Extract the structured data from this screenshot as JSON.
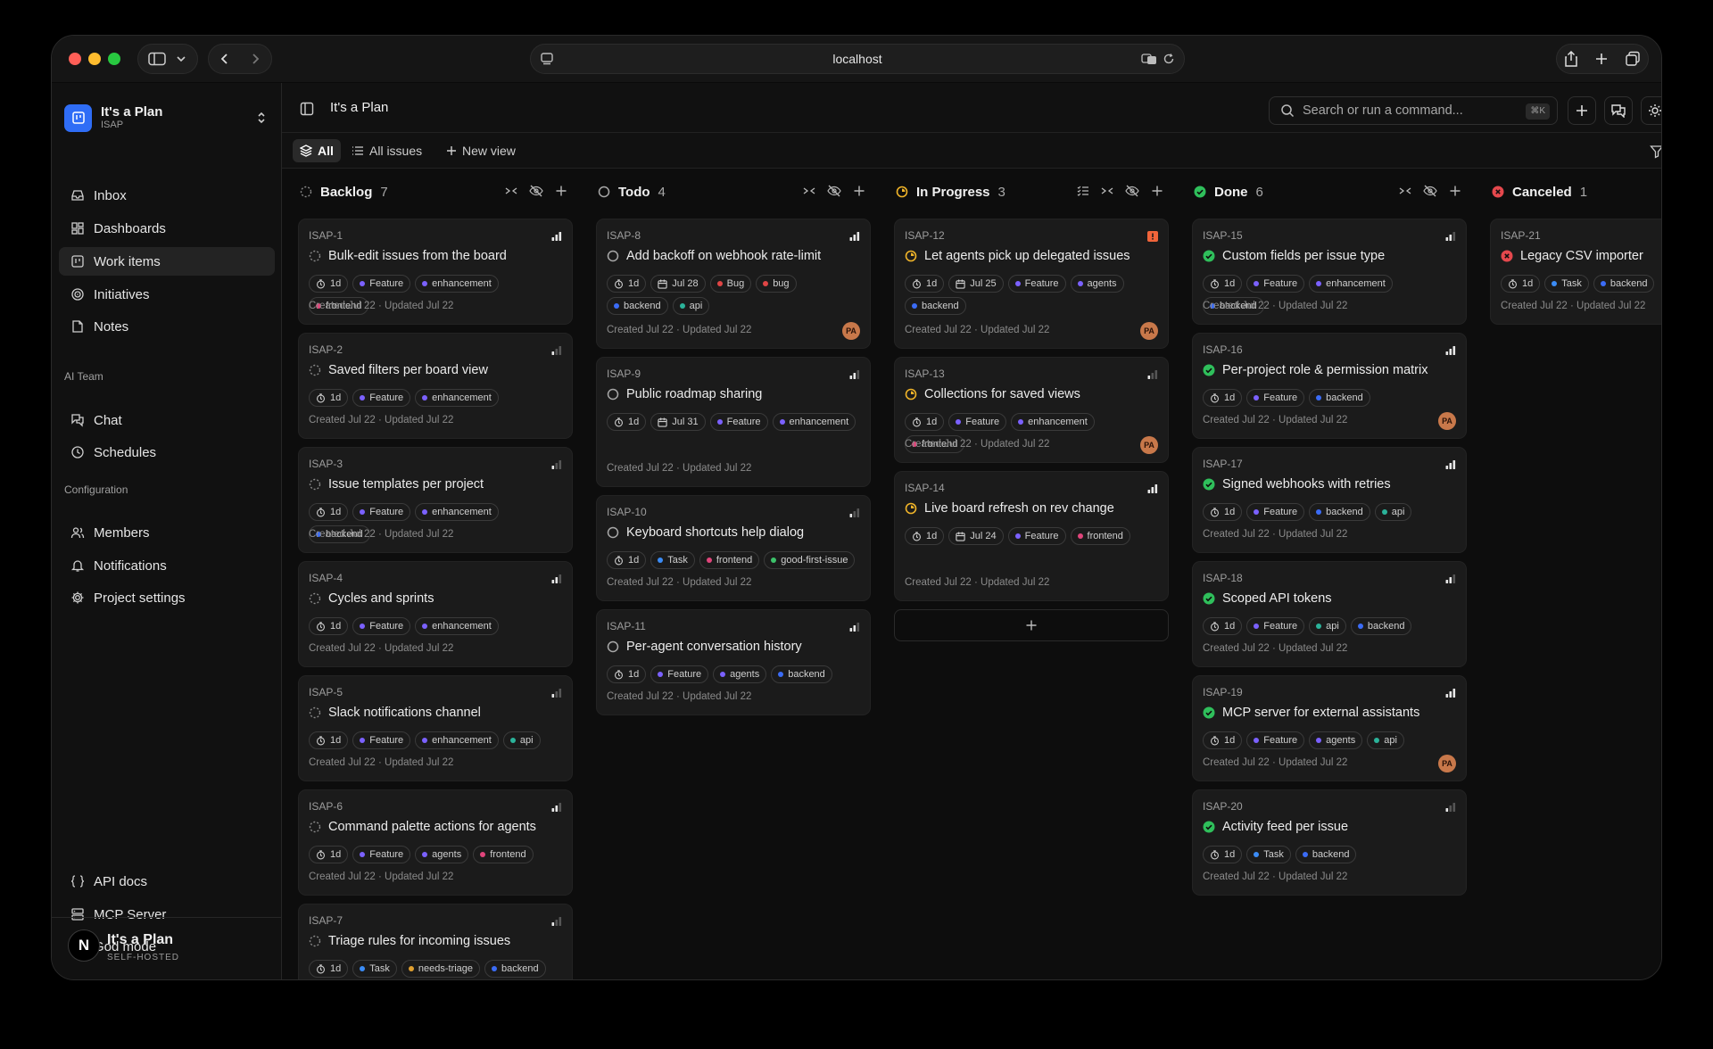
{
  "browser": {
    "url": "localhost"
  },
  "workspace": {
    "name": "It's a Plan",
    "key": "ISAP"
  },
  "nav": {
    "main": [
      {
        "label": "Inbox",
        "icon": "inbox-icon"
      },
      {
        "label": "Dashboards",
        "icon": "dashboard-icon"
      },
      {
        "label": "Work items",
        "icon": "work-items-icon"
      },
      {
        "label": "Initiatives",
        "icon": "target-icon"
      },
      {
        "label": "Notes",
        "icon": "note-icon"
      }
    ],
    "ai_section": "AI Team",
    "ai": [
      {
        "label": "Chat",
        "icon": "chat-icon"
      },
      {
        "label": "Schedules",
        "icon": "clock-icon"
      }
    ],
    "config_section": "Configuration",
    "config": [
      {
        "label": "Members",
        "icon": "users-icon"
      },
      {
        "label": "Notifications",
        "icon": "bell-icon"
      },
      {
        "label": "Project settings",
        "icon": "gear-icon"
      }
    ],
    "bottom": [
      {
        "label": "API docs",
        "icon": "braces-icon"
      },
      {
        "label": "MCP Server",
        "icon": "server-icon"
      },
      {
        "label": "God mode",
        "icon": "shield-icon"
      }
    ]
  },
  "brand": {
    "name": "It's a Plan",
    "sub": "SELF-HOSTED",
    "logo": "N"
  },
  "header": {
    "title": "It's a Plan",
    "search_placeholder": "Search or run a command...",
    "shortcut": "⌘K",
    "avatar": "PA"
  },
  "views": {
    "all": "All",
    "all_issues": "All issues",
    "new_view": "New view"
  },
  "columns": [
    {
      "name": "Backlog",
      "count": "7",
      "status": "backlog",
      "color": "#8a8a8a",
      "cards": [
        {
          "key": "ISAP-1",
          "title": "Bulk-edit issues from the board",
          "prio": 3,
          "tags": [
            {
              "t": "1d",
              "k": "est"
            },
            {
              "t": "Feature",
              "c": "#7b61ff"
            },
            {
              "t": "enhancement",
              "c": "#7b61ff"
            },
            {
              "t": "frontend",
              "c": "#e0457b"
            }
          ],
          "meta": "Created Jul 22 · Updated Jul 22"
        },
        {
          "key": "ISAP-2",
          "title": "Saved filters per board view",
          "prio": 1,
          "tags": [
            {
              "t": "1d",
              "k": "est"
            },
            {
              "t": "Feature",
              "c": "#7b61ff"
            },
            {
              "t": "enhancement",
              "c": "#7b61ff"
            }
          ],
          "meta": "Created Jul 22 · Updated Jul 22"
        },
        {
          "key": "ISAP-3",
          "title": "Issue templates per project",
          "prio": 1,
          "tags": [
            {
              "t": "1d",
              "k": "est"
            },
            {
              "t": "Feature",
              "c": "#7b61ff"
            },
            {
              "t": "enhancement",
              "c": "#7b61ff"
            },
            {
              "t": "backend",
              "c": "#3b6cf6"
            }
          ],
          "meta": "Created Jul 22 · Updated Jul 22"
        },
        {
          "key": "ISAP-4",
          "title": "Cycles and sprints",
          "prio": 2,
          "tags": [
            {
              "t": "1d",
              "k": "est"
            },
            {
              "t": "Feature",
              "c": "#7b61ff"
            },
            {
              "t": "enhancement",
              "c": "#7b61ff"
            }
          ],
          "meta": "Created Jul 22 · Updated Jul 22"
        },
        {
          "key": "ISAP-5",
          "title": "Slack notifications channel",
          "prio": 1,
          "tags": [
            {
              "t": "1d",
              "k": "est"
            },
            {
              "t": "Feature",
              "c": "#7b61ff"
            },
            {
              "t": "enhancement",
              "c": "#7b61ff"
            },
            {
              "t": "api",
              "c": "#2bb39a"
            }
          ],
          "meta": "Created Jul 22 · Updated Jul 22"
        },
        {
          "key": "ISAP-6",
          "title": "Command palette actions for agents",
          "prio": 2,
          "tags": [
            {
              "t": "1d",
              "k": "est"
            },
            {
              "t": "Feature",
              "c": "#7b61ff"
            },
            {
              "t": "agents",
              "c": "#7b61ff"
            },
            {
              "t": "frontend",
              "c": "#e0457b"
            }
          ],
          "meta": "Created Jul 22 · Updated Jul 22"
        },
        {
          "key": "ISAP-7",
          "title": "Triage rules for incoming issues",
          "prio": 1,
          "tags": [
            {
              "t": "1d",
              "k": "est"
            },
            {
              "t": "Task",
              "c": "#3b8cf6"
            },
            {
              "t": "needs-triage",
              "c": "#e0a030"
            },
            {
              "t": "backend",
              "c": "#3b6cf6"
            }
          ],
          "meta": ""
        }
      ]
    },
    {
      "name": "Todo",
      "count": "4",
      "status": "todo",
      "color": "#a0a0a0",
      "cards": [
        {
          "key": "ISAP-8",
          "title": "Add backoff on webhook rate-limit",
          "prio": 3,
          "tags": [
            {
              "t": "1d",
              "k": "est"
            },
            {
              "t": "Jul 28",
              "k": "date"
            },
            {
              "t": "Bug",
              "c": "#e04545"
            },
            {
              "t": "bug",
              "c": "#e04545"
            },
            {
              "t": "backend",
              "c": "#3b6cf6"
            },
            {
              "t": "api",
              "c": "#2bb39a"
            }
          ],
          "meta": "Created Jul 22 · Updated Jul 22",
          "avatar": "PA"
        },
        {
          "key": "ISAP-9",
          "title": "Public roadmap sharing",
          "prio": 2,
          "tags": [
            {
              "t": "1d",
              "k": "est"
            },
            {
              "t": "Jul 31",
              "k": "date"
            },
            {
              "t": "Feature",
              "c": "#7b61ff"
            },
            {
              "t": "enhancement",
              "c": "#7b61ff"
            }
          ],
          "meta": "Created Jul 22 · Updated Jul 22"
        },
        {
          "key": "ISAP-10",
          "title": "Keyboard shortcuts help dialog",
          "prio": 1,
          "tags": [
            {
              "t": "1d",
              "k": "est"
            },
            {
              "t": "Task",
              "c": "#3b8cf6"
            },
            {
              "t": "frontend",
              "c": "#e0457b"
            },
            {
              "t": "good-first-issue",
              "c": "#3cc26a"
            }
          ],
          "meta": "Created Jul 22 · Updated Jul 22"
        },
        {
          "key": "ISAP-11",
          "title": "Per-agent conversation history",
          "prio": 2,
          "tags": [
            {
              "t": "1d",
              "k": "est"
            },
            {
              "t": "Feature",
              "c": "#7b61ff"
            },
            {
              "t": "agents",
              "c": "#7b61ff"
            },
            {
              "t": "backend",
              "c": "#3b6cf6"
            }
          ],
          "meta": "Created Jul 22 · Updated Jul 22"
        }
      ]
    },
    {
      "name": "In Progress",
      "count": "3",
      "status": "progress",
      "color": "#f0b429",
      "cards": [
        {
          "key": "ISAP-12",
          "title": "Let agents pick up delegated issues",
          "prio": 4,
          "tags": [
            {
              "t": "1d",
              "k": "est"
            },
            {
              "t": "Jul 25",
              "k": "date"
            },
            {
              "t": "Feature",
              "c": "#7b61ff"
            },
            {
              "t": "agents",
              "c": "#7b61ff"
            },
            {
              "t": "backend",
              "c": "#3b6cf6"
            }
          ],
          "meta": "Created Jul 22 · Updated Jul 22",
          "avatar": "PA"
        },
        {
          "key": "ISAP-13",
          "title": "Collections for saved views",
          "prio": 1,
          "tags": [
            {
              "t": "1d",
              "k": "est"
            },
            {
              "t": "Feature",
              "c": "#7b61ff"
            },
            {
              "t": "enhancement",
              "c": "#7b61ff"
            },
            {
              "t": "frontend",
              "c": "#e0457b"
            }
          ],
          "meta": "Created Jul 22 · Updated Jul 22",
          "avatar": "PA"
        },
        {
          "key": "ISAP-14",
          "title": "Live board refresh on rev change",
          "prio": 3,
          "tags": [
            {
              "t": "1d",
              "k": "est"
            },
            {
              "t": "Jul 24",
              "k": "date"
            },
            {
              "t": "Feature",
              "c": "#7b61ff"
            },
            {
              "t": "frontend",
              "c": "#e0457b"
            }
          ],
          "meta": "Created Jul 22 · Updated Jul 22"
        }
      ]
    },
    {
      "name": "Done",
      "count": "6",
      "status": "done",
      "color": "#2fbf5b",
      "cards": [
        {
          "key": "ISAP-15",
          "title": "Custom fields per issue type",
          "prio": 2,
          "tags": [
            {
              "t": "1d",
              "k": "est"
            },
            {
              "t": "Feature",
              "c": "#7b61ff"
            },
            {
              "t": "enhancement",
              "c": "#7b61ff"
            },
            {
              "t": "backend",
              "c": "#3b6cf6"
            }
          ],
          "meta": "Created Jul 22 · Updated Jul 22"
        },
        {
          "key": "ISAP-16",
          "title": "Per-project role & permission matrix",
          "prio": 3,
          "tags": [
            {
              "t": "1d",
              "k": "est"
            },
            {
              "t": "Feature",
              "c": "#7b61ff"
            },
            {
              "t": "backend",
              "c": "#3b6cf6"
            }
          ],
          "meta": "Created Jul 22 · Updated Jul 22",
          "avatar": "PA"
        },
        {
          "key": "ISAP-17",
          "title": "Signed webhooks with retries",
          "prio": 3,
          "tags": [
            {
              "t": "1d",
              "k": "est"
            },
            {
              "t": "Feature",
              "c": "#7b61ff"
            },
            {
              "t": "backend",
              "c": "#3b6cf6"
            },
            {
              "t": "api",
              "c": "#2bb39a"
            }
          ],
          "meta": "Created Jul 22 · Updated Jul 22"
        },
        {
          "key": "ISAP-18",
          "title": "Scoped API tokens",
          "prio": 2,
          "tags": [
            {
              "t": "1d",
              "k": "est"
            },
            {
              "t": "Feature",
              "c": "#7b61ff"
            },
            {
              "t": "api",
              "c": "#2bb39a"
            },
            {
              "t": "backend",
              "c": "#3b6cf6"
            }
          ],
          "meta": "Created Jul 22 · Updated Jul 22"
        },
        {
          "key": "ISAP-19",
          "title": "MCP server for external assistants",
          "prio": 3,
          "tags": [
            {
              "t": "1d",
              "k": "est"
            },
            {
              "t": "Feature",
              "c": "#7b61ff"
            },
            {
              "t": "agents",
              "c": "#7b61ff"
            },
            {
              "t": "api",
              "c": "#2bb39a"
            }
          ],
          "meta": "Created Jul 22 · Updated Jul 22",
          "avatar": "PA"
        },
        {
          "key": "ISAP-20",
          "title": "Activity feed per issue",
          "prio": 1,
          "tags": [
            {
              "t": "1d",
              "k": "est"
            },
            {
              "t": "Task",
              "c": "#3b8cf6"
            },
            {
              "t": "backend",
              "c": "#3b6cf6"
            }
          ],
          "meta": "Created Jul 22 · Updated Jul 22"
        }
      ]
    },
    {
      "name": "Canceled",
      "count": "1",
      "status": "canceled",
      "color": "#e5484d",
      "cards": [
        {
          "key": "ISAP-21",
          "title": "Legacy CSV importer",
          "prio": 0,
          "tags": [
            {
              "t": "1d",
              "k": "est"
            },
            {
              "t": "Task",
              "c": "#3b8cf6"
            },
            {
              "t": "backend",
              "c": "#3b6cf6"
            }
          ],
          "meta": "Created Jul 22 · Updated Jul 22"
        }
      ]
    }
  ]
}
